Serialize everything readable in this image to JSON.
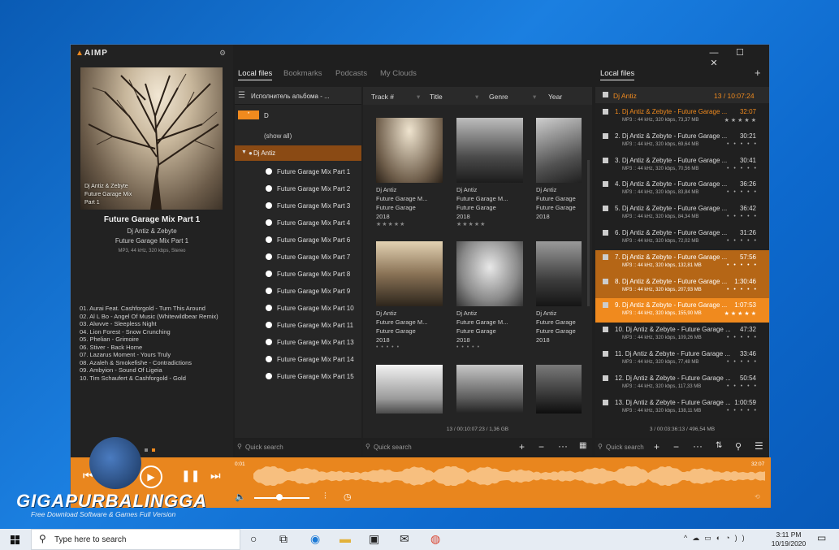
{
  "app": {
    "logo": "AIMP",
    "win_min": "—",
    "win_max": "☐",
    "win_close": "✕"
  },
  "tabs": [
    "Local files",
    "Bookmarks",
    "Podcasts",
    "My Clouds"
  ],
  "playlist_tab": "Local files",
  "now_playing": {
    "cover_text": [
      "Dj Antiz & Zebyte",
      "Future Garage Mix",
      "Part 1"
    ],
    "title": "Future Garage Mix Part 1",
    "artist": "Dj Antiz & Zebyte",
    "album": "Future Garage Mix Part 1",
    "format": "MP3, 44 kHz, 320 kbps, Stereo"
  },
  "tracklist": [
    "01. Aurai Feat. Cashforgold - Turn This Around",
    "02. Al L Bo - Angel Of Music (Whitewildbear Remix)",
    "03. Alwvve - Sleepless Night",
    "04. Lion Forest - Snow Crunching",
    "05. Phelian - Grimoire",
    "06. Stiver - Back Home",
    "07. Lazarus Moment - Yours Truly",
    "08. Azaleh & Smokefishe - Contradictions",
    "09. Ambyion - Sound Of Ligeia",
    "10. Tim Schaufert & Cashforgold - Gold"
  ],
  "tree": {
    "header": "Исполнитель альбома - ...",
    "filter_btn": "*",
    "filter_val": "D",
    "show_all": "(show all)",
    "artist": "Dj Antiz",
    "albums": [
      "Future Garage Mix Part 1",
      "Future Garage Mix Part 2",
      "Future Garage Mix Part 3",
      "Future Garage Mix Part 4",
      "Future Garage Mix Part 6",
      "Future Garage Mix Part 7",
      "Future Garage Mix Part 8",
      "Future Garage Mix Part 9",
      "Future Garage Mix Part 10",
      "Future Garage Mix Part 11",
      "Future Garage Mix Part 13",
      "Future Garage Mix Part 14",
      "Future Garage Mix Part 15"
    ],
    "search_placeholder": "Quick search"
  },
  "grid": {
    "columns": [
      "Track #",
      "Title",
      "Genre",
      "Year"
    ],
    "tiles": [
      {
        "artist": "Dj Antiz",
        "album": "Future Garage M...",
        "genre": "Future Garage",
        "year": "2018",
        "stars": "★★★★★"
      },
      {
        "artist": "Dj Antiz",
        "album": "Future Garage M...",
        "genre": "Future Garage",
        "year": "2018",
        "stars": "★★★★★"
      },
      {
        "artist": "Dj Antiz",
        "album": "Future Garage",
        "genre": "Future Garage",
        "year": "2018",
        "stars": ""
      },
      {
        "artist": "Dj Antiz",
        "album": "Future Garage M...",
        "genre": "Future Garage",
        "year": "2018",
        "stars": "• • • • •"
      },
      {
        "artist": "Dj Antiz",
        "album": "Future Garage M...",
        "genre": "Future Garage",
        "year": "2018",
        "stars": "• • • • •"
      },
      {
        "artist": "Dj Antiz",
        "album": "Future Garage",
        "genre": "Future Garage",
        "year": "2018",
        "stars": ""
      }
    ],
    "status": "13 / 00:10:07:23 / 1,36 GB",
    "search_placeholder": "Quick search"
  },
  "playlist": {
    "name": "Dj Antiz",
    "count": "13 / 10:07:24",
    "items": [
      {
        "title": "1. Dj Antiz & Zebyte - Future Garage ...",
        "info": "MP3 :: 44 kHz, 320 kbps, 73,37 MB",
        "dur": "32:07",
        "rating": "★★★★★"
      },
      {
        "title": "2. Dj Antiz & Zebyte - Future Garage ...",
        "info": "MP3 :: 44 kHz, 320 kbps, 69,64 MB",
        "dur": "30:21",
        "rating": "• • • • •"
      },
      {
        "title": "3. Dj Antiz & Zebyte - Future Garage ...",
        "info": "MP3 :: 44 kHz, 320 kbps, 70,56 MB",
        "dur": "30:41",
        "rating": "• • • • •"
      },
      {
        "title": "4. Dj Antiz & Zebyte - Future Garage ...",
        "info": "MP3 :: 44 kHz, 320 kbps, 83,84 MB",
        "dur": "36:26",
        "rating": "• • • • •"
      },
      {
        "title": "5. Dj Antiz & Zebyte - Future Garage ...",
        "info": "MP3 :: 44 kHz, 320 kbps, 84,34 MB",
        "dur": "36:42",
        "rating": "• • • • •"
      },
      {
        "title": "6. Dj Antiz & Zebyte - Future Garage ...",
        "info": "MP3 :: 44 kHz, 320 kbps, 72,02 MB",
        "dur": "31:26",
        "rating": "• • • • •"
      },
      {
        "title": "7. Dj Antiz & Zebyte - Future Garage ...",
        "info": "MP3 :: 44 kHz, 320 kbps, 132,81 MB",
        "dur": "57:56",
        "rating": "• • • • •"
      },
      {
        "title": "8. Dj Antiz & Zebyte - Future Garage ...",
        "info": "MP3 :: 44 kHz, 320 kbps, 207,93 MB",
        "dur": "1:30:46",
        "rating": "• • • • •"
      },
      {
        "title": "9. Dj Antiz & Zebyte - Future Garage ...",
        "info": "MP3 :: 44 kHz, 320 kbps, 155,90 MB",
        "dur": "1:07:53",
        "rating": "★★★★★"
      },
      {
        "title": "10. Dj Antiz & Zebyte - Future Garage ...",
        "info": "MP3 :: 44 kHz, 320 kbps, 109,26 MB",
        "dur": "47:32",
        "rating": "• • • • •"
      },
      {
        "title": "11. Dj Antiz & Zebyte - Future Garage ...",
        "info": "MP3 :: 44 kHz, 320 kbps, 77,48 MB",
        "dur": "33:46",
        "rating": "• • • • •"
      },
      {
        "title": "12. Dj Antiz & Zebyte - Future Garage ...",
        "info": "MP3 :: 44 kHz, 320 kbps, 117,33 MB",
        "dur": "50:54",
        "rating": "• • • • •"
      },
      {
        "title": "13. Dj Antiz & Zebyte - Future Garage ...",
        "info": "MP3 :: 44 kHz, 320 kbps, 138,11 MB",
        "dur": "1:00:59",
        "rating": "• • • • •"
      }
    ],
    "status": "3 / 00:03:36:13 / 496,54 MB",
    "search_placeholder": "Quick search"
  },
  "player": {
    "time_elapsed": "0:01",
    "time_total": "32:07",
    "volume": 0.45
  },
  "watermark": {
    "title": "GIGAPURBALINGGA",
    "subtitle": "Free Download Software & Games Full Version"
  },
  "taskbar": {
    "search_placeholder": "Type here to search",
    "time": "3:11 PM",
    "date": "10/19/2020"
  }
}
